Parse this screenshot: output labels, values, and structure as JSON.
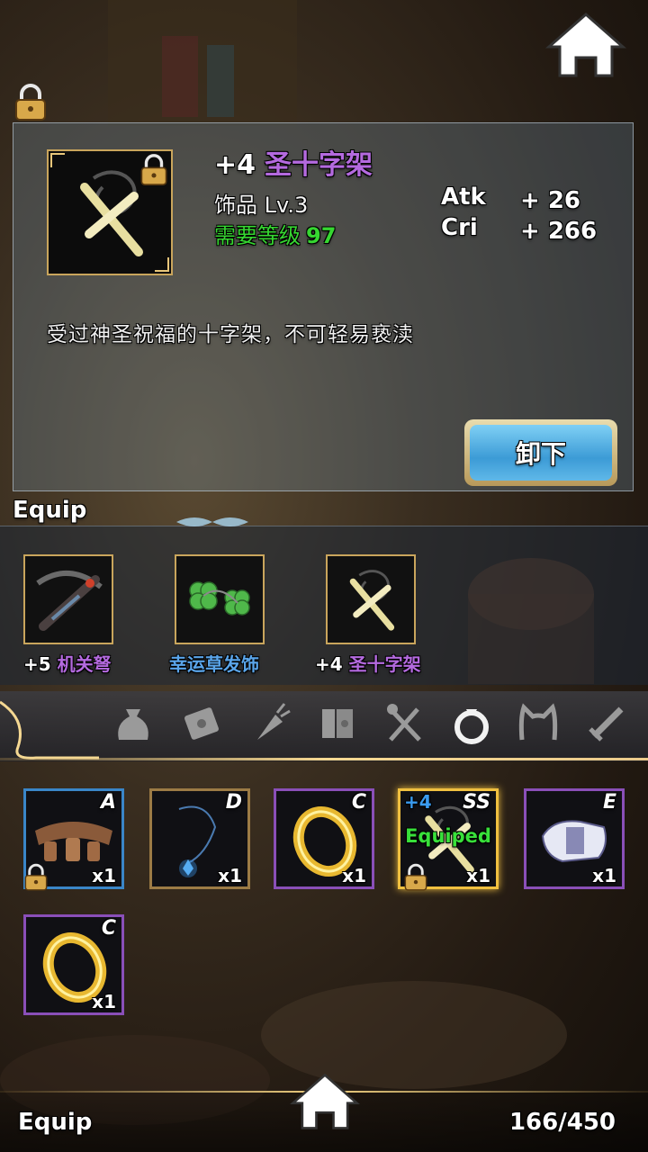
{
  "selected_item": {
    "enhance": "+4",
    "name": "圣十字架",
    "type_level": "饰品 Lv.3",
    "req_label": "需要等级",
    "req_level": "97",
    "stats": [
      {
        "label": "Atk",
        "value": "+ 26"
      },
      {
        "label": "Cri",
        "value": "+ 266"
      }
    ],
    "description": "受过神圣祝福的十字架，不可轻易亵渎",
    "action_label": "卸下"
  },
  "equip_section": {
    "title": "Equip",
    "slots": [
      {
        "plus": "+5",
        "name": "机关弩",
        "name_color": "#b46adf",
        "icon": "crossbow-icon"
      },
      {
        "plus": "",
        "name": "幸运草发饰",
        "name_color": "#5aa5ea",
        "icon": "clover-icon"
      },
      {
        "plus": "+4",
        "name": "圣十字架",
        "name_color": "#b46adf",
        "icon": "cross-icon"
      }
    ]
  },
  "categories": [
    {
      "icon": "bag-icon",
      "active": false
    },
    {
      "icon": "scroll-icon",
      "active": false
    },
    {
      "icon": "carrot-icon",
      "active": false
    },
    {
      "icon": "book-icon",
      "active": false
    },
    {
      "icon": "fork-spoon-icon",
      "active": false
    },
    {
      "icon": "ring-icon",
      "active": true
    },
    {
      "icon": "cat-ears-icon",
      "active": false
    },
    {
      "icon": "sword-icon",
      "active": false
    }
  ],
  "inventory": [
    {
      "grade": "A",
      "qty": "x1",
      "icon": "belt-icon",
      "border": "#3a86c8",
      "locked": true
    },
    {
      "grade": "D",
      "qty": "x1",
      "icon": "pendant-icon",
      "border": "#9c7b45",
      "locked": false
    },
    {
      "grade": "C",
      "qty": "x1",
      "icon": "gold-ring-icon",
      "border": "#8a4fb8",
      "locked": false
    },
    {
      "grade": "SS",
      "qty": "x1",
      "icon": "cross-icon",
      "border": "#f0c040",
      "locked": true,
      "plus": "+4",
      "status": "Equiped"
    },
    {
      "grade": "E",
      "qty": "x1",
      "icon": "gauntlet-icon",
      "border": "#8a4fb8",
      "locked": false
    },
    {
      "grade": "C",
      "qty": "x1",
      "icon": "gold-ring-icon",
      "border": "#8a4fb8",
      "locked": false
    }
  ],
  "footer": {
    "title": "Equip",
    "capacity": "166/450"
  },
  "colors": {
    "accent_purple": "#b46adf",
    "accent_green": "#36d631",
    "accent_blue": "#3a9bf0",
    "gold": "#c9a55c"
  }
}
